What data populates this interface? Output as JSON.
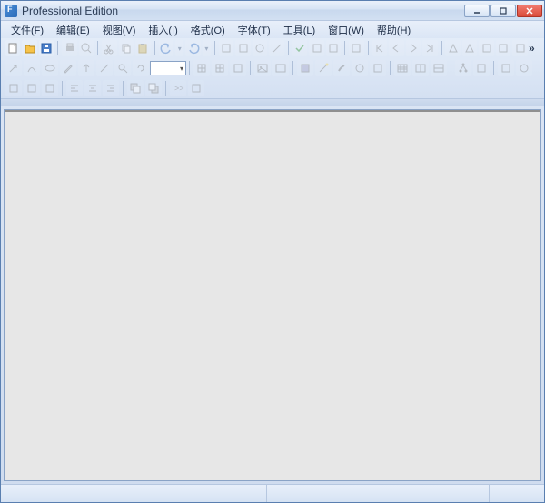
{
  "window": {
    "title": "Professional Edition"
  },
  "menu": {
    "file": "文件(F)",
    "edit": "编辑(E)",
    "view": "视图(V)",
    "insert": "插入(I)",
    "format": "格式(O)",
    "font": "字体(T)",
    "tools": "工具(L)",
    "window": "窗口(W)",
    "help": "帮助(H)"
  },
  "toolbar": {
    "combo_value": ""
  },
  "icons": {
    "new": "new-doc",
    "open": "open-folder",
    "save": "save",
    "print": "print",
    "cut": "cut",
    "copy": "copy",
    "paste": "paste",
    "undo": "undo",
    "redo": "redo"
  }
}
